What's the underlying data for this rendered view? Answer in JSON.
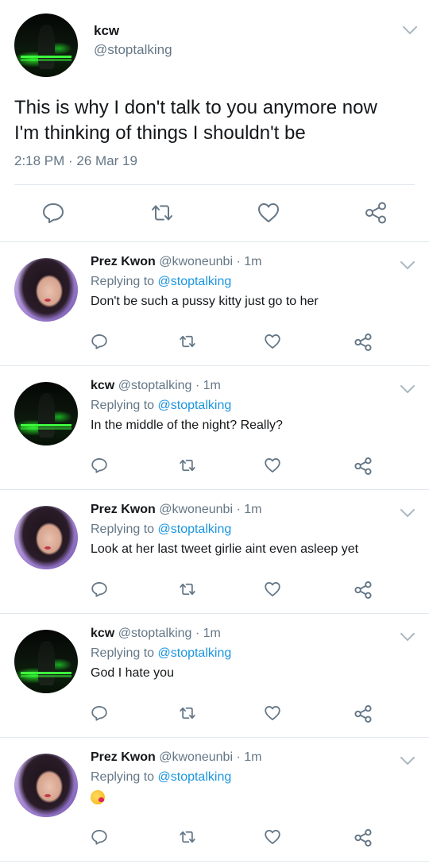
{
  "main_tweet": {
    "author_name": "kcw",
    "author_handle": "@stoptalking",
    "text_line1": "This is why I don't talk to you anymore now",
    "text_line2": "I'm thinking of things I shouldn't be",
    "timestamp": "2:18 PM · 26 Mar 19"
  },
  "replies": [
    {
      "name": "Prez Kwon",
      "meta": "@kwoneunbi · 1m",
      "replying_prefix": "Replying to",
      "replying_to": "@stoptalking",
      "text": "Don't be such a pussy kitty just go to her",
      "avatar": "prez-avatar"
    },
    {
      "name": "kcw",
      "meta": "@stoptalking · 1m",
      "replying_prefix": "Replying to",
      "replying_to": "@stoptalking",
      "text": "In the middle of the night? Really?",
      "avatar": "kcw-avatar"
    },
    {
      "name": "Prez Kwon",
      "meta": "@kwoneunbi · 1m",
      "replying_prefix": "Replying to",
      "replying_to": "@stoptalking",
      "text": "Look at her last tweet girlie aint even asleep yet",
      "avatar": "prez-avatar"
    },
    {
      "name": "kcw",
      "meta": "@stoptalking · 1m",
      "replying_prefix": "Replying to",
      "replying_to": "@stoptalking",
      "text": "God I hate you",
      "avatar": "kcw-avatar"
    },
    {
      "name": "Prez Kwon",
      "meta": "@kwoneunbi · 1m",
      "replying_prefix": "Replying to",
      "replying_to": "@stoptalking",
      "text": "",
      "emoji": "kissing-heart-emoji",
      "avatar": "prez-avatar"
    }
  ],
  "icons": {
    "reply": "reply-icon",
    "retweet": "retweet-icon",
    "like": "like-icon",
    "share": "share-icon",
    "menu": "chevron-down-icon"
  },
  "colors": {
    "link": "#1b95e0",
    "secondary_text": "#657786",
    "icon_gray": "#657786",
    "chevron": "#aab8c2",
    "divider": "#e1e8ed"
  }
}
